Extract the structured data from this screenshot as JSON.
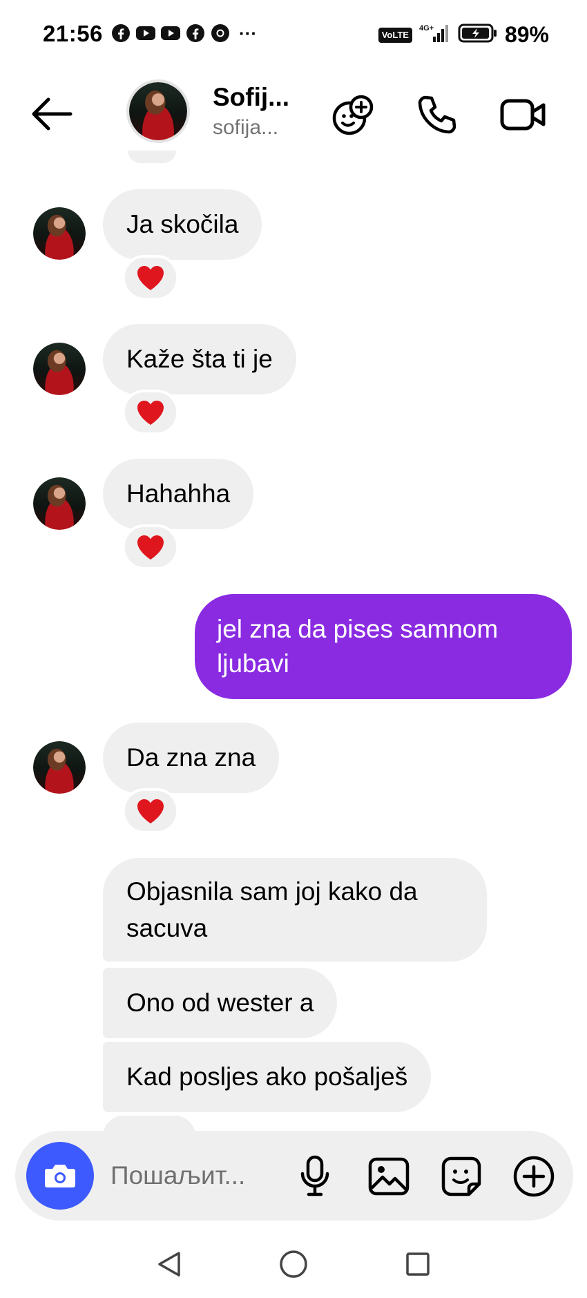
{
  "status_bar": {
    "time": "21:56",
    "dots": "···",
    "volte": "VoLTE",
    "network": "4G+",
    "battery": "89%",
    "app_icons": [
      "facebook-icon",
      "youtube-icon",
      "youtube-icon",
      "facebook-icon",
      "chrome-icon"
    ]
  },
  "header": {
    "name": "Sofij...",
    "username": "sofija..."
  },
  "messages": [
    {
      "direction": "in",
      "text": "Ja skočila",
      "reaction": "❤️"
    },
    {
      "direction": "in",
      "text": "Kaže šta ti je",
      "reaction": "❤️"
    },
    {
      "direction": "in",
      "text": "Hahahha",
      "reaction": "❤️"
    },
    {
      "direction": "out",
      "text": "jel zna da pises samnom ljubavi"
    },
    {
      "direction": "in",
      "text": "Da zna zna",
      "reaction": "❤️"
    },
    {
      "direction": "in",
      "text": "Objasnila sam joj kako da sacuva"
    },
    {
      "direction": "in",
      "text": "Ono od wester a"
    },
    {
      "direction": "in",
      "text": "Kad posljes ako pošalješ"
    }
  ],
  "composer": {
    "placeholder": "Пошаљит..."
  },
  "colors": {
    "outgoing_bubble": "#8a2be2",
    "incoming_bubble": "#efefef",
    "camera_button": "#3d5afe"
  }
}
